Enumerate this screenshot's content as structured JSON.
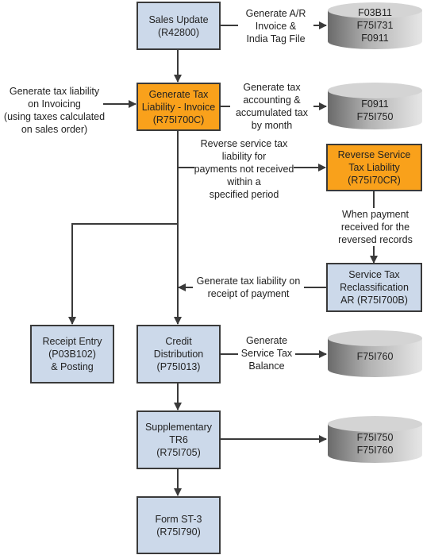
{
  "boxes": {
    "sales_update": [
      "Sales Update",
      "(R42800)"
    ],
    "gen_tax_invoice": [
      "Generate Tax",
      "Liability - Invoice",
      "(R75I700C)"
    ],
    "reverse_service_tax": [
      "Reverse Service",
      "Tax Liability",
      "(R75I70CR)"
    ],
    "reclassification": [
      "Service Tax",
      "Reclassification",
      "AR (R75I700B)"
    ],
    "receipt_entry": [
      "Receipt Entry",
      "(P03B102)",
      "& Posting"
    ],
    "credit_distribution": [
      "Credit",
      "Distribution",
      "(P75I013)"
    ],
    "supplementary_tr6": [
      "Supplementary",
      "TR6",
      "(R75I705)"
    ],
    "form_st3": [
      "Form ST-3",
      "(R75I790)"
    ]
  },
  "databases": {
    "db1": [
      "F03B11",
      "F75I731",
      "F0911"
    ],
    "db2": [
      "F0911",
      "F75I750"
    ],
    "db3": [
      "F75I760"
    ],
    "db4": [
      "F75I750",
      "F75I760"
    ]
  },
  "labels": {
    "ar_invoice": [
      "Generate A/R",
      "Invoice &",
      "India Tag File"
    ],
    "tax_accounting": [
      "Generate tax",
      "accounting &",
      "accumulated tax",
      "by month"
    ],
    "invoicing_input": [
      "Generate tax liability",
      "on Invoicing",
      "(using taxes calculated",
      "on sales order)"
    ],
    "reverse": [
      "Reverse service tax",
      "liability for",
      "payments not received",
      "within a",
      "specified period"
    ],
    "payment_received": [
      "When payment",
      "received for the",
      "reversed records"
    ],
    "receipt_of_payment": [
      "Generate tax liability on",
      "receipt of payment"
    ],
    "service_tax_balance": [
      "Generate",
      "Service Tax",
      "Balance"
    ]
  },
  "colors": {
    "process": "#ccd9ea",
    "highlight": "#f9a11b",
    "line": "#3a3a3a"
  }
}
